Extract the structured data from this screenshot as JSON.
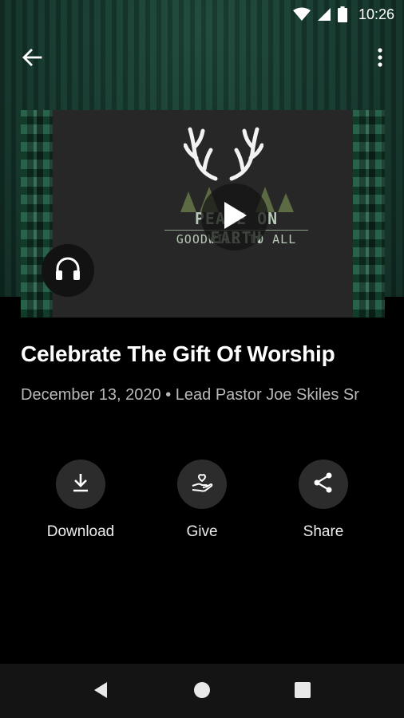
{
  "status_bar": {
    "time": "10:26"
  },
  "header": {
    "back_icon": "arrow-back-icon",
    "menu_icon": "more-vert-icon"
  },
  "media": {
    "artwork_line1": "PEACE ON EARTH",
    "artwork_line2": "GOODWILL TO ALL",
    "play_icon": "play-icon",
    "audio_icon": "headphones-icon"
  },
  "sermon": {
    "title": "Celebrate The Gift Of Worship",
    "meta": "December 13, 2020 • Lead Pastor Joe Skiles Sr"
  },
  "actions": [
    {
      "label": "Download",
      "icon": "download-icon"
    },
    {
      "label": "Give",
      "icon": "give-heart-hand-icon"
    },
    {
      "label": "Share",
      "icon": "share-icon"
    }
  ],
  "colors": {
    "background": "#000000",
    "hero_green": "#163a2f",
    "secondary_text": "#b9b9b9",
    "action_circle": "#2c2c2c"
  }
}
